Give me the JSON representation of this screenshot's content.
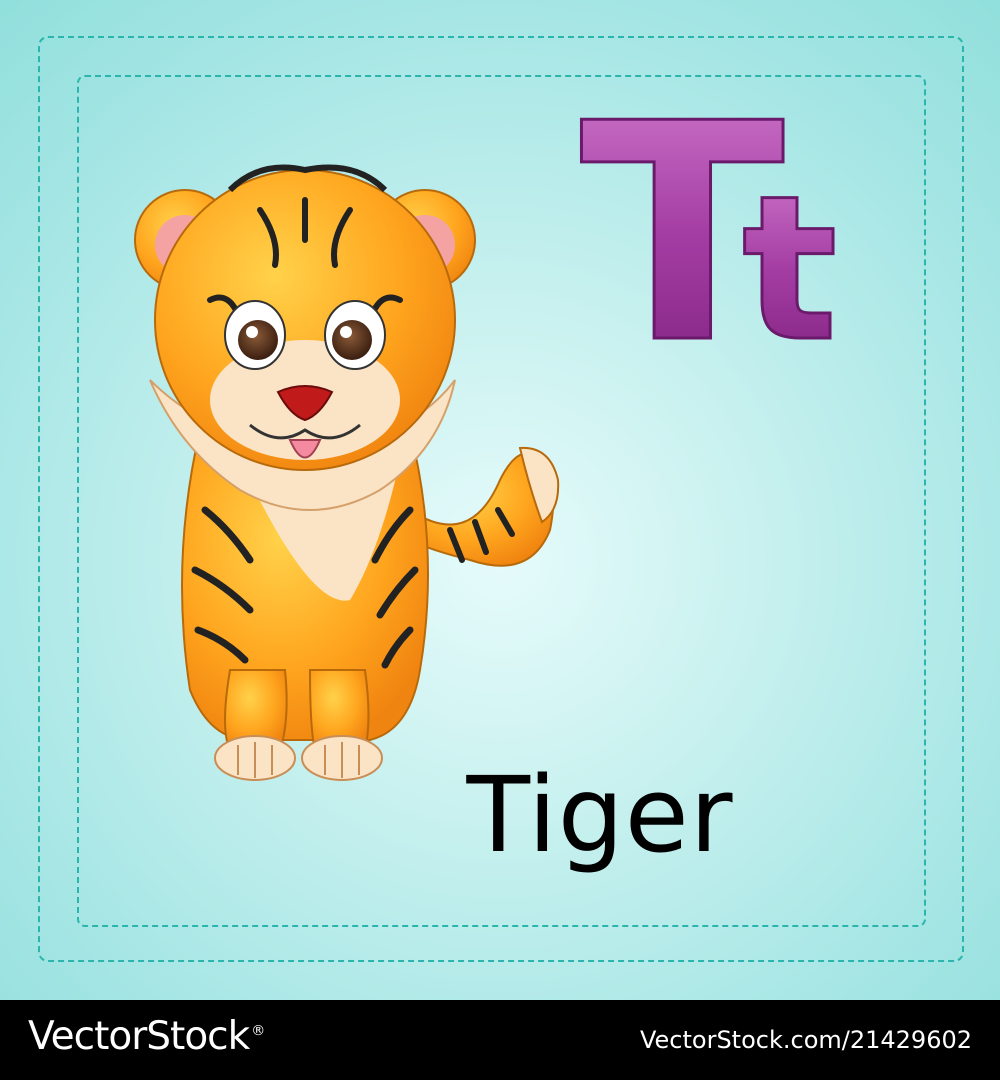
{
  "card": {
    "letter_upper": "T",
    "letter_lower": "t",
    "word": "Tiger",
    "letter_color": "#a43da3",
    "dash_color": "#2bb5ac"
  },
  "footer": {
    "brand": "VectorStock",
    "registered_mark": "®",
    "image_id": "VectorStock.com/21429602"
  }
}
